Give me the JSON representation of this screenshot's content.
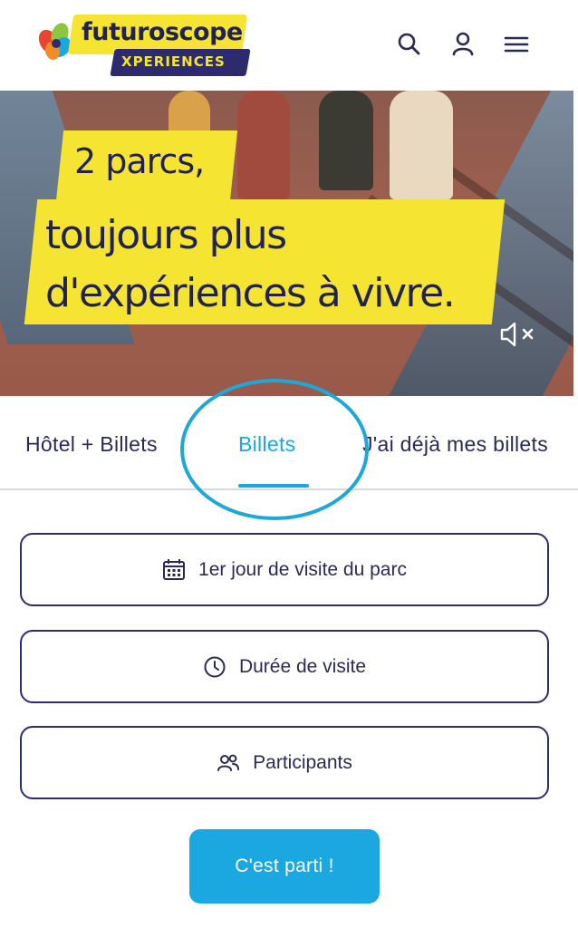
{
  "header": {
    "logo_primary": "futuroscope",
    "logo_secondary": "XPERIENCES",
    "icons": [
      "search-icon",
      "account-icon",
      "menu-icon"
    ]
  },
  "hero": {
    "headline_line1": "2 parcs,",
    "headline_line2a": "toujours plus",
    "headline_line2b": "d'expériences à vivre.",
    "mute_icon": "speaker-muted-icon"
  },
  "tabs": [
    {
      "label": "Hôtel + Billets",
      "active": false
    },
    {
      "label": "Billets",
      "active": true
    },
    {
      "label": "J'ai déjà mes billets",
      "active": false
    }
  ],
  "form": {
    "date_label": "1er jour de visite du parc",
    "duration_label": "Durée de visite",
    "participants_label": "Participants",
    "submit_label": "C'est parti !"
  },
  "colors": {
    "brand_yellow": "#f5e431",
    "brand_navy": "#2d2a6e",
    "accent_blue": "#1ba7df"
  }
}
